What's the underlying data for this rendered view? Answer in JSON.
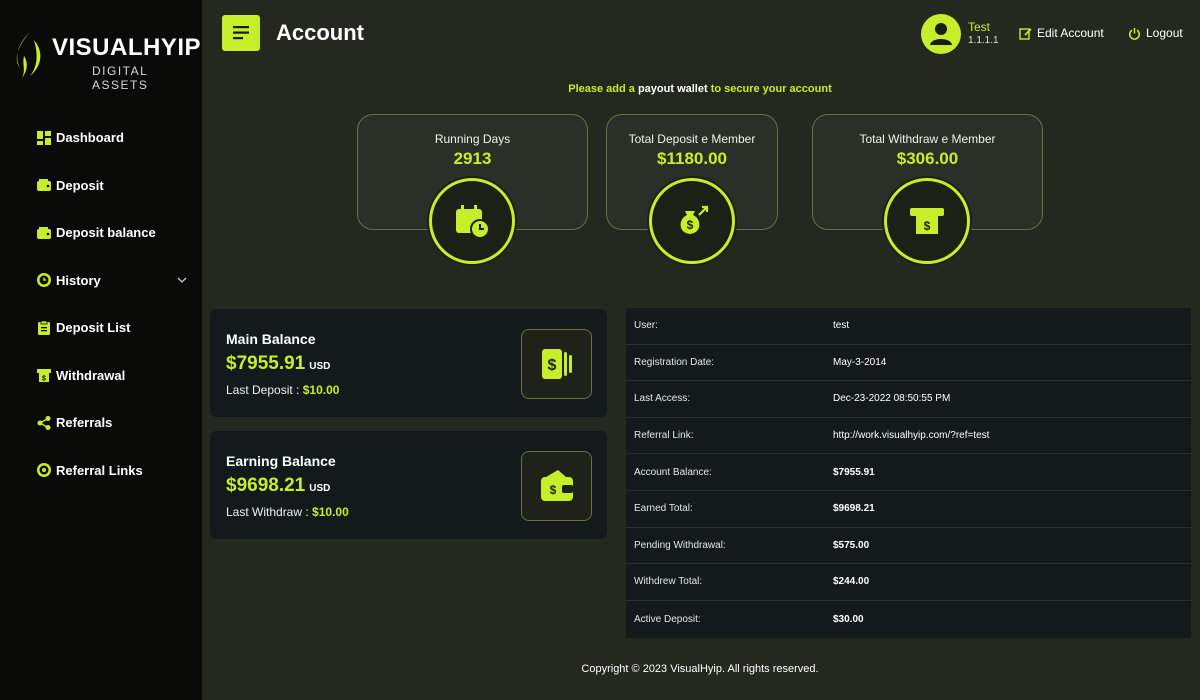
{
  "brand": {
    "name": "VISUALHYIP",
    "tagline": "DIGITAL ASSETS"
  },
  "header": {
    "title": "Account",
    "user_name": "Test",
    "user_sub": "1.1.1.1",
    "edit_label": "Edit Account",
    "logout_label": "Logout"
  },
  "sidebar": {
    "items": [
      {
        "label": "Dashboard",
        "icon": "dashboard-icon"
      },
      {
        "label": "Deposit",
        "icon": "wallet-icon"
      },
      {
        "label": "Deposit balance",
        "icon": "wallet-icon"
      },
      {
        "label": "History",
        "icon": "clock-icon"
      },
      {
        "label": "Deposit List",
        "icon": "clipboard-icon"
      },
      {
        "label": "Withdrawal",
        "icon": "withdraw-icon"
      },
      {
        "label": "Referrals",
        "icon": "share-icon"
      },
      {
        "label": "Referral Links",
        "icon": "link-icon"
      }
    ]
  },
  "notice": {
    "prefix": "Please add a",
    "link_text": "payout wallet",
    "suffix": "to secure your account"
  },
  "stats": [
    {
      "label": "Running Days",
      "value": "2913",
      "icon": "calendar-clock-icon"
    },
    {
      "label": "Total Deposit e Member",
      "value": "$1180.00",
      "icon": "money-bag-icon"
    },
    {
      "label": "Total Withdraw e Member",
      "value": "$306.00",
      "icon": "atm-icon"
    }
  ],
  "balances": [
    {
      "title": "Main Balance",
      "amount": "$7955.91",
      "currency": "USD",
      "foot_label": "Last Deposit :",
      "foot_value": "$10.00",
      "icon": "cash-stack-icon"
    },
    {
      "title": "Earning Balance",
      "amount": "$9698.21",
      "currency": "USD",
      "foot_label": "Last Withdraw :",
      "foot_value": "$10.00",
      "icon": "wallet-dollar-icon"
    }
  ],
  "account_info": [
    {
      "key": "User:",
      "value": "test"
    },
    {
      "key": "Registration Date:",
      "value": "May-3-2014"
    },
    {
      "key": "Last Access:",
      "value": "Dec-23-2022 08:50:55 PM"
    },
    {
      "key": "Referral Link:",
      "value": "http://work.visualhyip.com/?ref=test"
    },
    {
      "key": "Account Balance:",
      "value": "$7955.91"
    },
    {
      "key": "Earned Total:",
      "value": "$9698.21"
    },
    {
      "key": "Pending Withdrawal:",
      "value": "$575.00"
    },
    {
      "key": "Withdrew Total:",
      "value": "$244.00"
    },
    {
      "key": "Active Deposit:",
      "value": "$30.00"
    }
  ],
  "footer": {
    "text": "Copyright © 2023 VisualHyip. All rights reserved."
  },
  "colors": {
    "accent": "#c6ee2a",
    "sidebar_bg": "#0a0b09",
    "page_bg": "#25281f",
    "card_bg": "#141a1c"
  }
}
